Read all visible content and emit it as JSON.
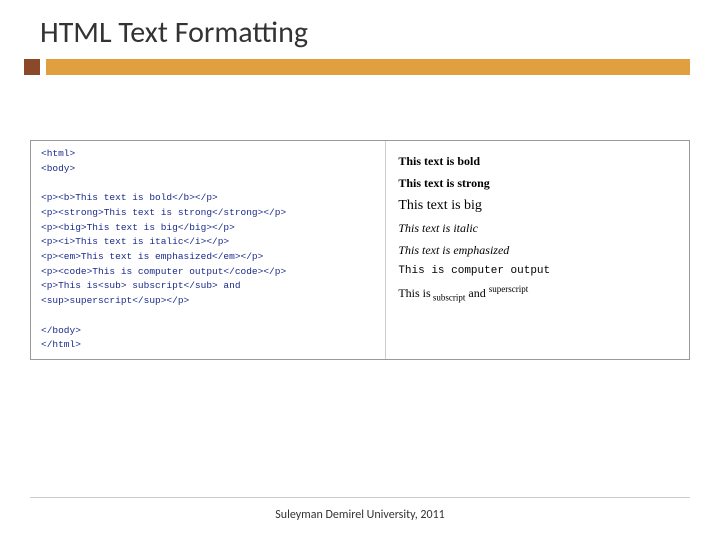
{
  "title": "HTML Text Formatting",
  "code": {
    "lines": [
      "<html>",
      "<body>",
      "",
      "<p><b>This text is bold</b></p>",
      "<p><strong>This text is strong</strong></p>",
      "<p><big>This text is big</big></p>",
      "<p><i>This text is italic</i></p>",
      "<p><em>This text is emphasized</em></p>",
      "<p><code>This is computer output</code></p>",
      "<p>This is<sub> subscript</sub> and",
      "<sup>superscript</sup></p>",
      "",
      "</body>",
      "</html>"
    ]
  },
  "output": {
    "bold": "This text is bold",
    "strong": "This text is strong",
    "big": "This text is big",
    "italic": "This text is italic",
    "emphasized": "This text is emphasized",
    "code": "This is computer output",
    "subsup_prefix": "This is",
    "sub": " subscript",
    "mid": " and ",
    "sup": "superscript"
  },
  "footer": "Suleyman Demirel University, 2011"
}
